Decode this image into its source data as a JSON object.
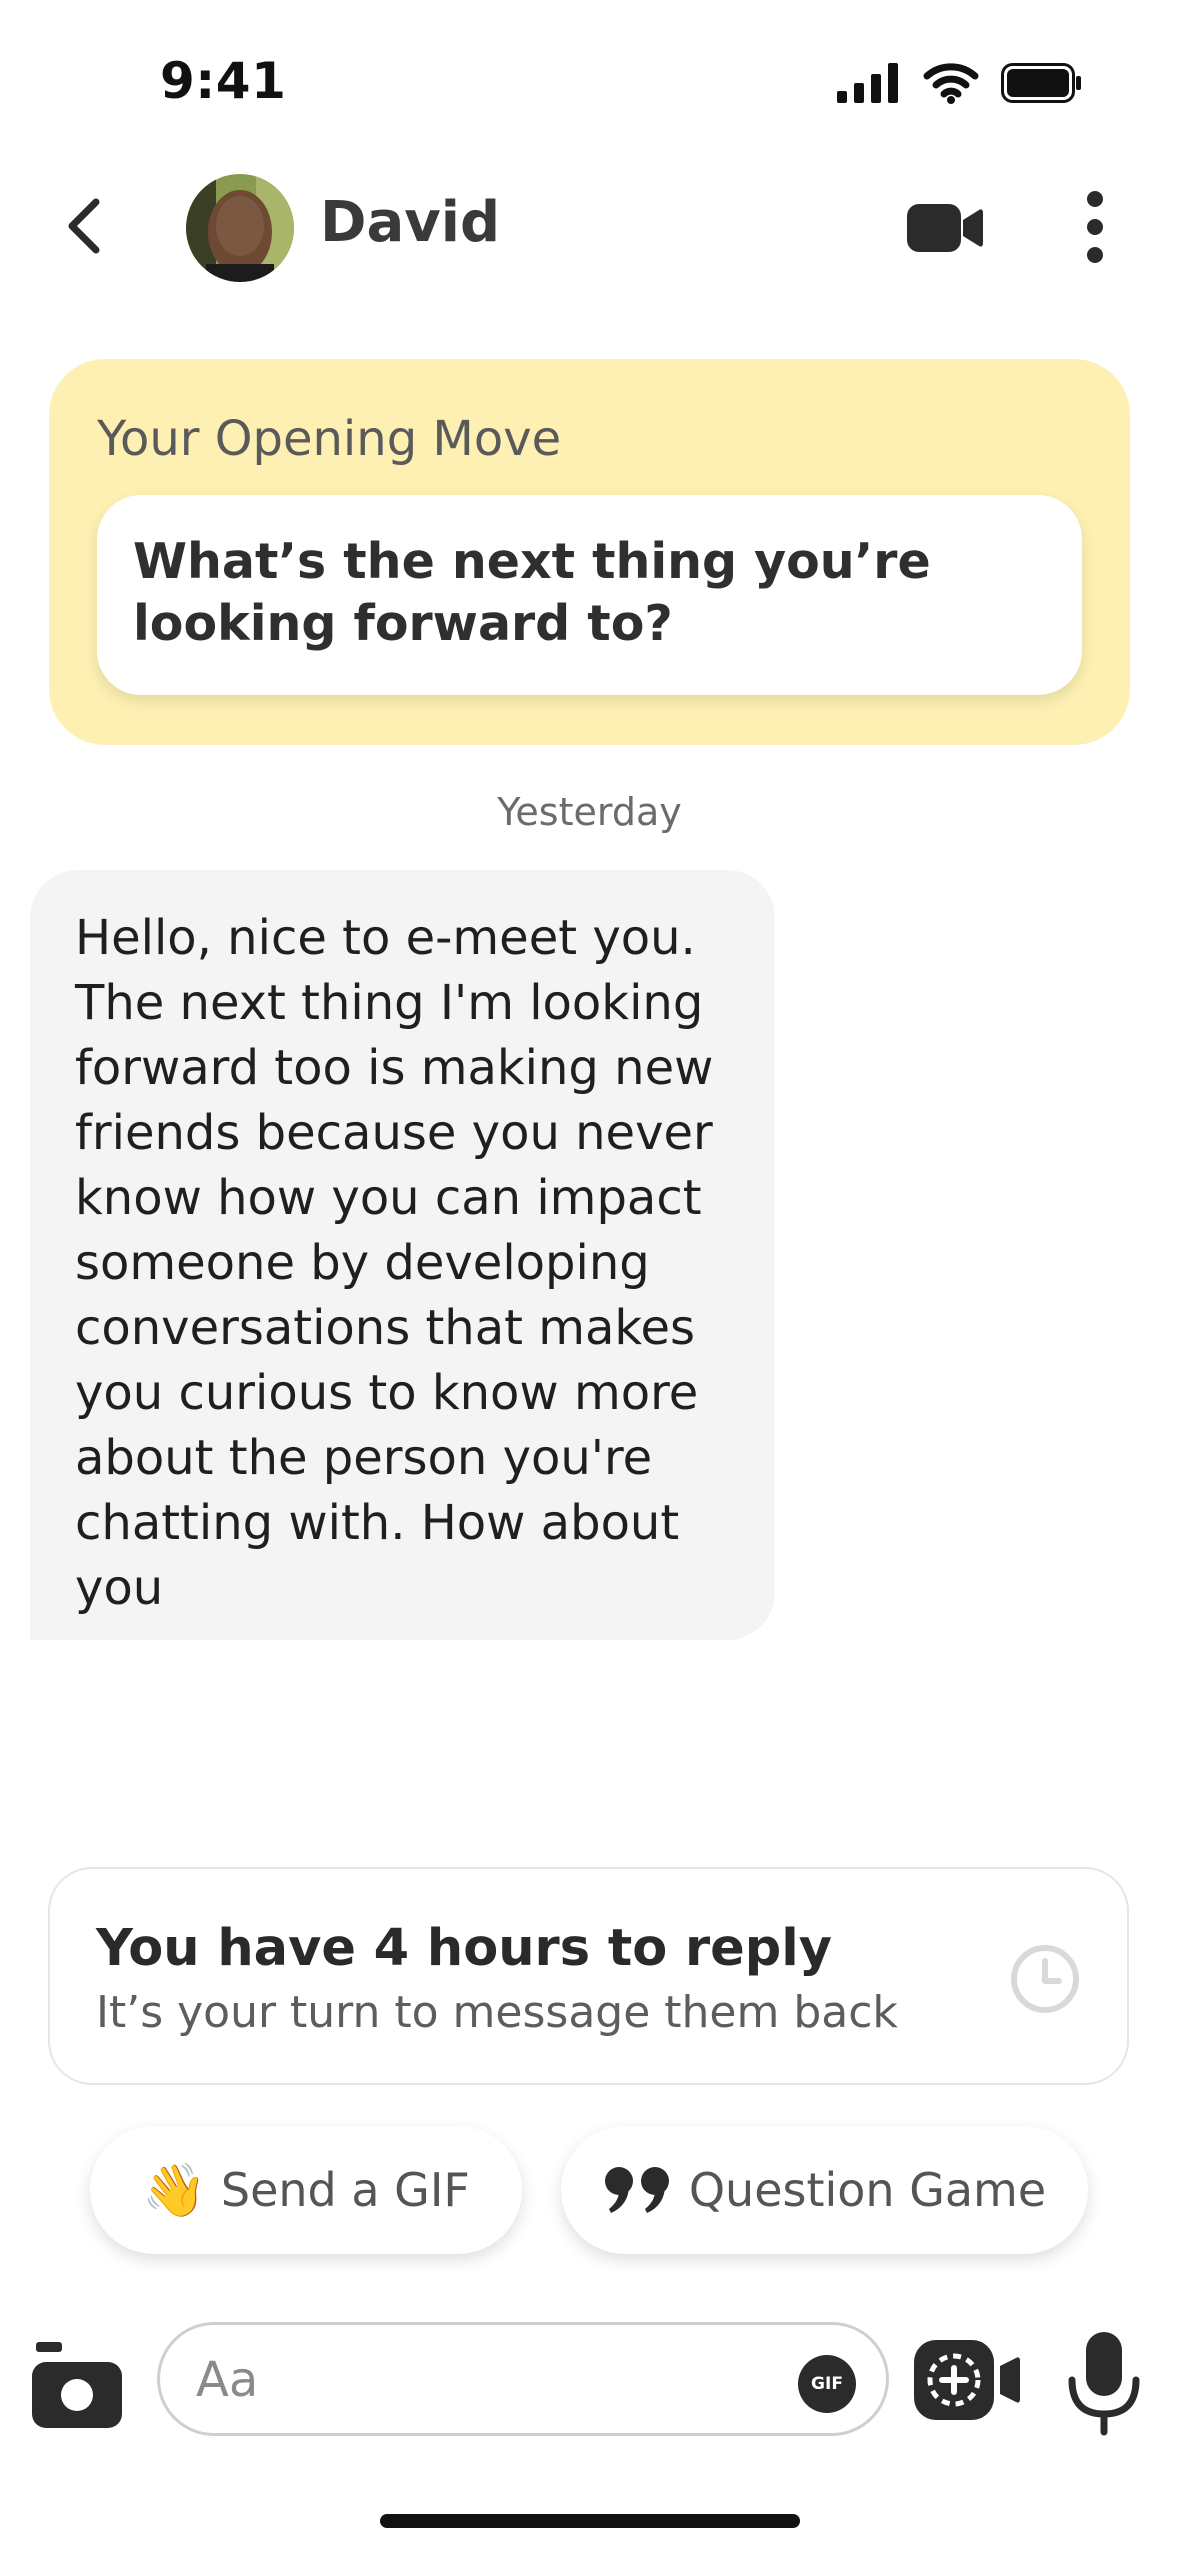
{
  "status_bar": {
    "time": "9:41"
  },
  "header": {
    "contact_name": "David"
  },
  "opening_move": {
    "label": "Your Opening Move",
    "question": "What’s the next thing you’re looking forward to?",
    "background_color": "#fdf0b2"
  },
  "conversation": {
    "timestamp": "Yesterday",
    "messages": [
      {
        "sender": "David",
        "text": "Hello, nice to e-meet you. The next thing I'm looking forward too is making new friends because you never know how you can impact someone by developing conversations that makes you curious to know more about the person you're chatting with. How about you"
      }
    ]
  },
  "reply_notice": {
    "title": "You have 4 hours to reply",
    "subtitle": "It’s your turn to message them back",
    "icon": "clock-icon"
  },
  "quick_actions": {
    "gif": {
      "emoji": "👋",
      "label": "Send a GIF"
    },
    "question_game": {
      "icon": "quote-icon",
      "label": "Question Game"
    }
  },
  "composer": {
    "placeholder": "Aa",
    "value": "",
    "gif_badge": "GIF"
  },
  "colors": {
    "opening_card": "#fdf0b2",
    "message_bubble": "#f4f4f4",
    "icon_dark": "#2b2b2b"
  }
}
